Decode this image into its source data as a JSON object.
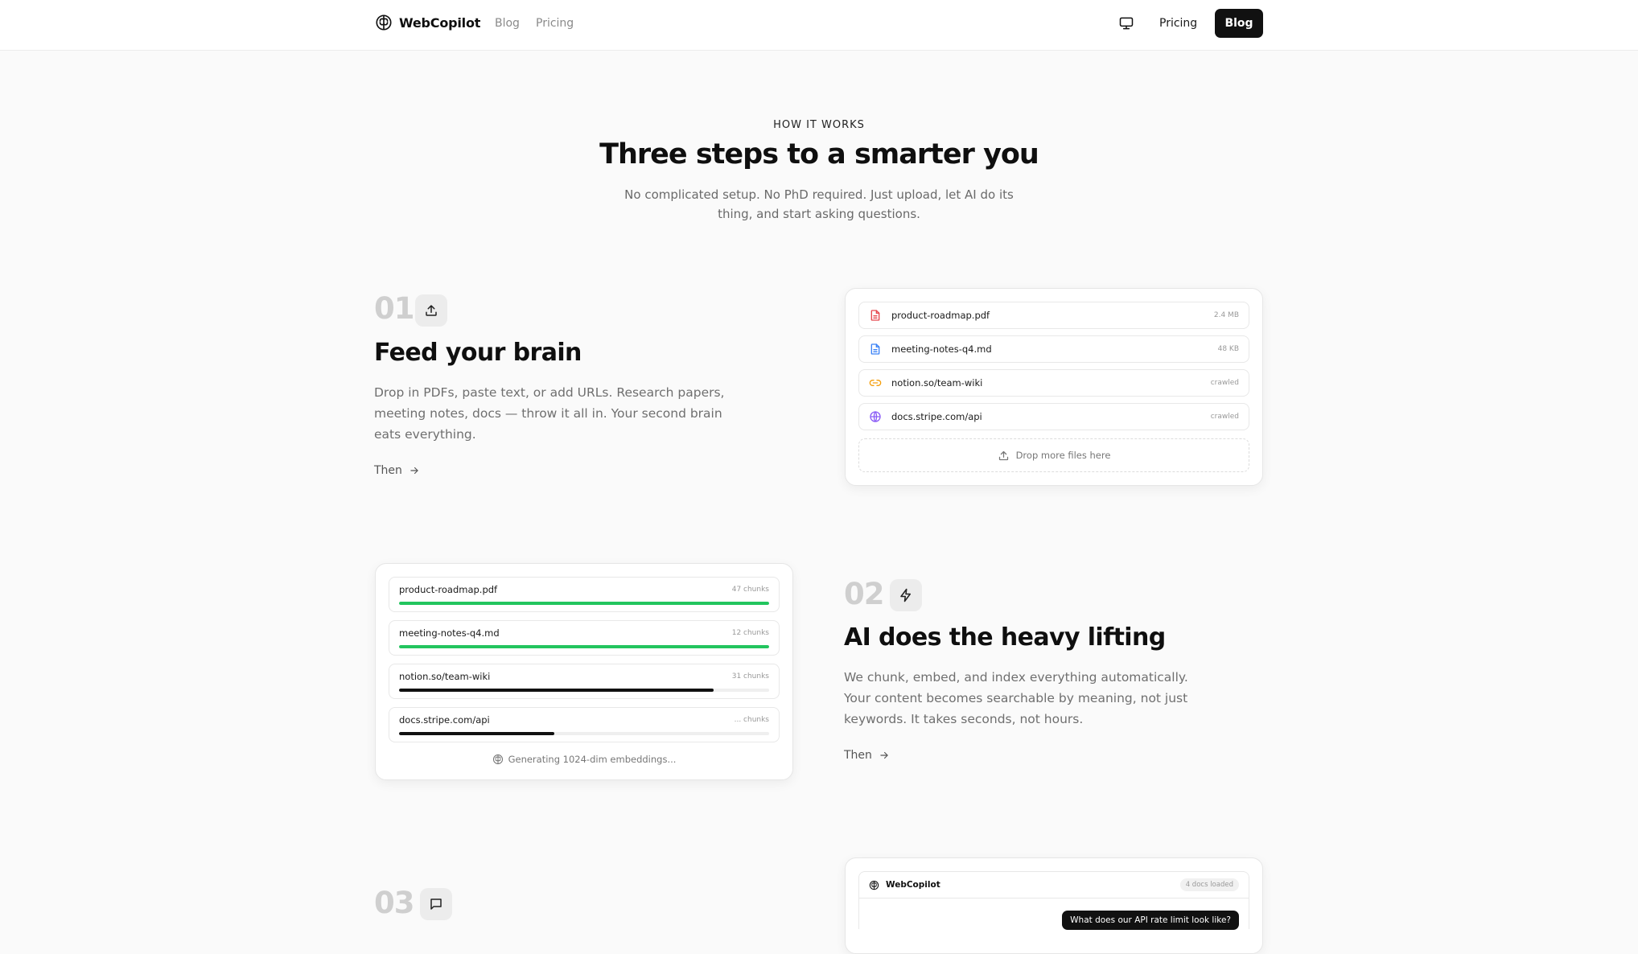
{
  "nav": {
    "logo_text": "WebCopilot",
    "links": [
      "Blog",
      "Pricing"
    ],
    "right_pricing": "Pricing",
    "right_blog": "Blog"
  },
  "hero": {
    "eyebrow": "HOW IT WORKS",
    "title": "Three steps to a smarter you",
    "subtitle": "No complicated setup. No PhD required. Just upload, let AI do its thing, and start asking questions."
  },
  "steps": [
    {
      "num": "01",
      "icon": "upload-icon",
      "title": "Feed your brain",
      "desc": "Drop in PDFs, paste text, or add URLs. Research papers, meeting notes, docs — throw it all in. Your second brain eats everything.",
      "then": "Then"
    },
    {
      "num": "02",
      "icon": "lightning-icon",
      "title": "AI does the heavy lifting",
      "desc": "We chunk, embed, and index everything automatically. Your content becomes searchable by meaning, not just keywords. It takes seconds, not hours.",
      "then": "Then"
    },
    {
      "num": "03",
      "icon": "chat-icon"
    }
  ],
  "upload_card": {
    "files": [
      {
        "name": "product-roadmap.pdf",
        "meta": "2.4 MB",
        "icon": "pdf-file-icon",
        "color": "#e5484d"
      },
      {
        "name": "meeting-notes-q4.md",
        "meta": "48 KB",
        "icon": "doc-file-icon",
        "color": "#3b82f6"
      },
      {
        "name": "notion.so/team-wiki",
        "meta": "crawled",
        "icon": "link-icon",
        "color": "#f59e0b"
      },
      {
        "name": "docs.stripe.com/api",
        "meta": "crawled",
        "icon": "globe-icon",
        "color": "#8b5cf6"
      }
    ],
    "drop_label": "Drop more files here"
  },
  "process_card": {
    "rows": [
      {
        "name": "product-roadmap.pdf",
        "meta": "47 chunks",
        "progress": 1.0,
        "color": "#22c55e"
      },
      {
        "name": "meeting-notes-q4.md",
        "meta": "12 chunks",
        "progress": 1.0,
        "color": "#22c55e"
      },
      {
        "name": "notion.so/team-wiki",
        "meta": "31 chunks",
        "progress": 0.85,
        "color": "#111111"
      },
      {
        "name": "docs.stripe.com/api",
        "meta": "... chunks",
        "progress": 0.42,
        "color": "#111111"
      }
    ],
    "status": "Generating 1024-dim embeddings..."
  },
  "chat_card": {
    "name": "WebCopilot",
    "badge": "4 docs loaded",
    "question": "What does our API rate limit look like?"
  }
}
